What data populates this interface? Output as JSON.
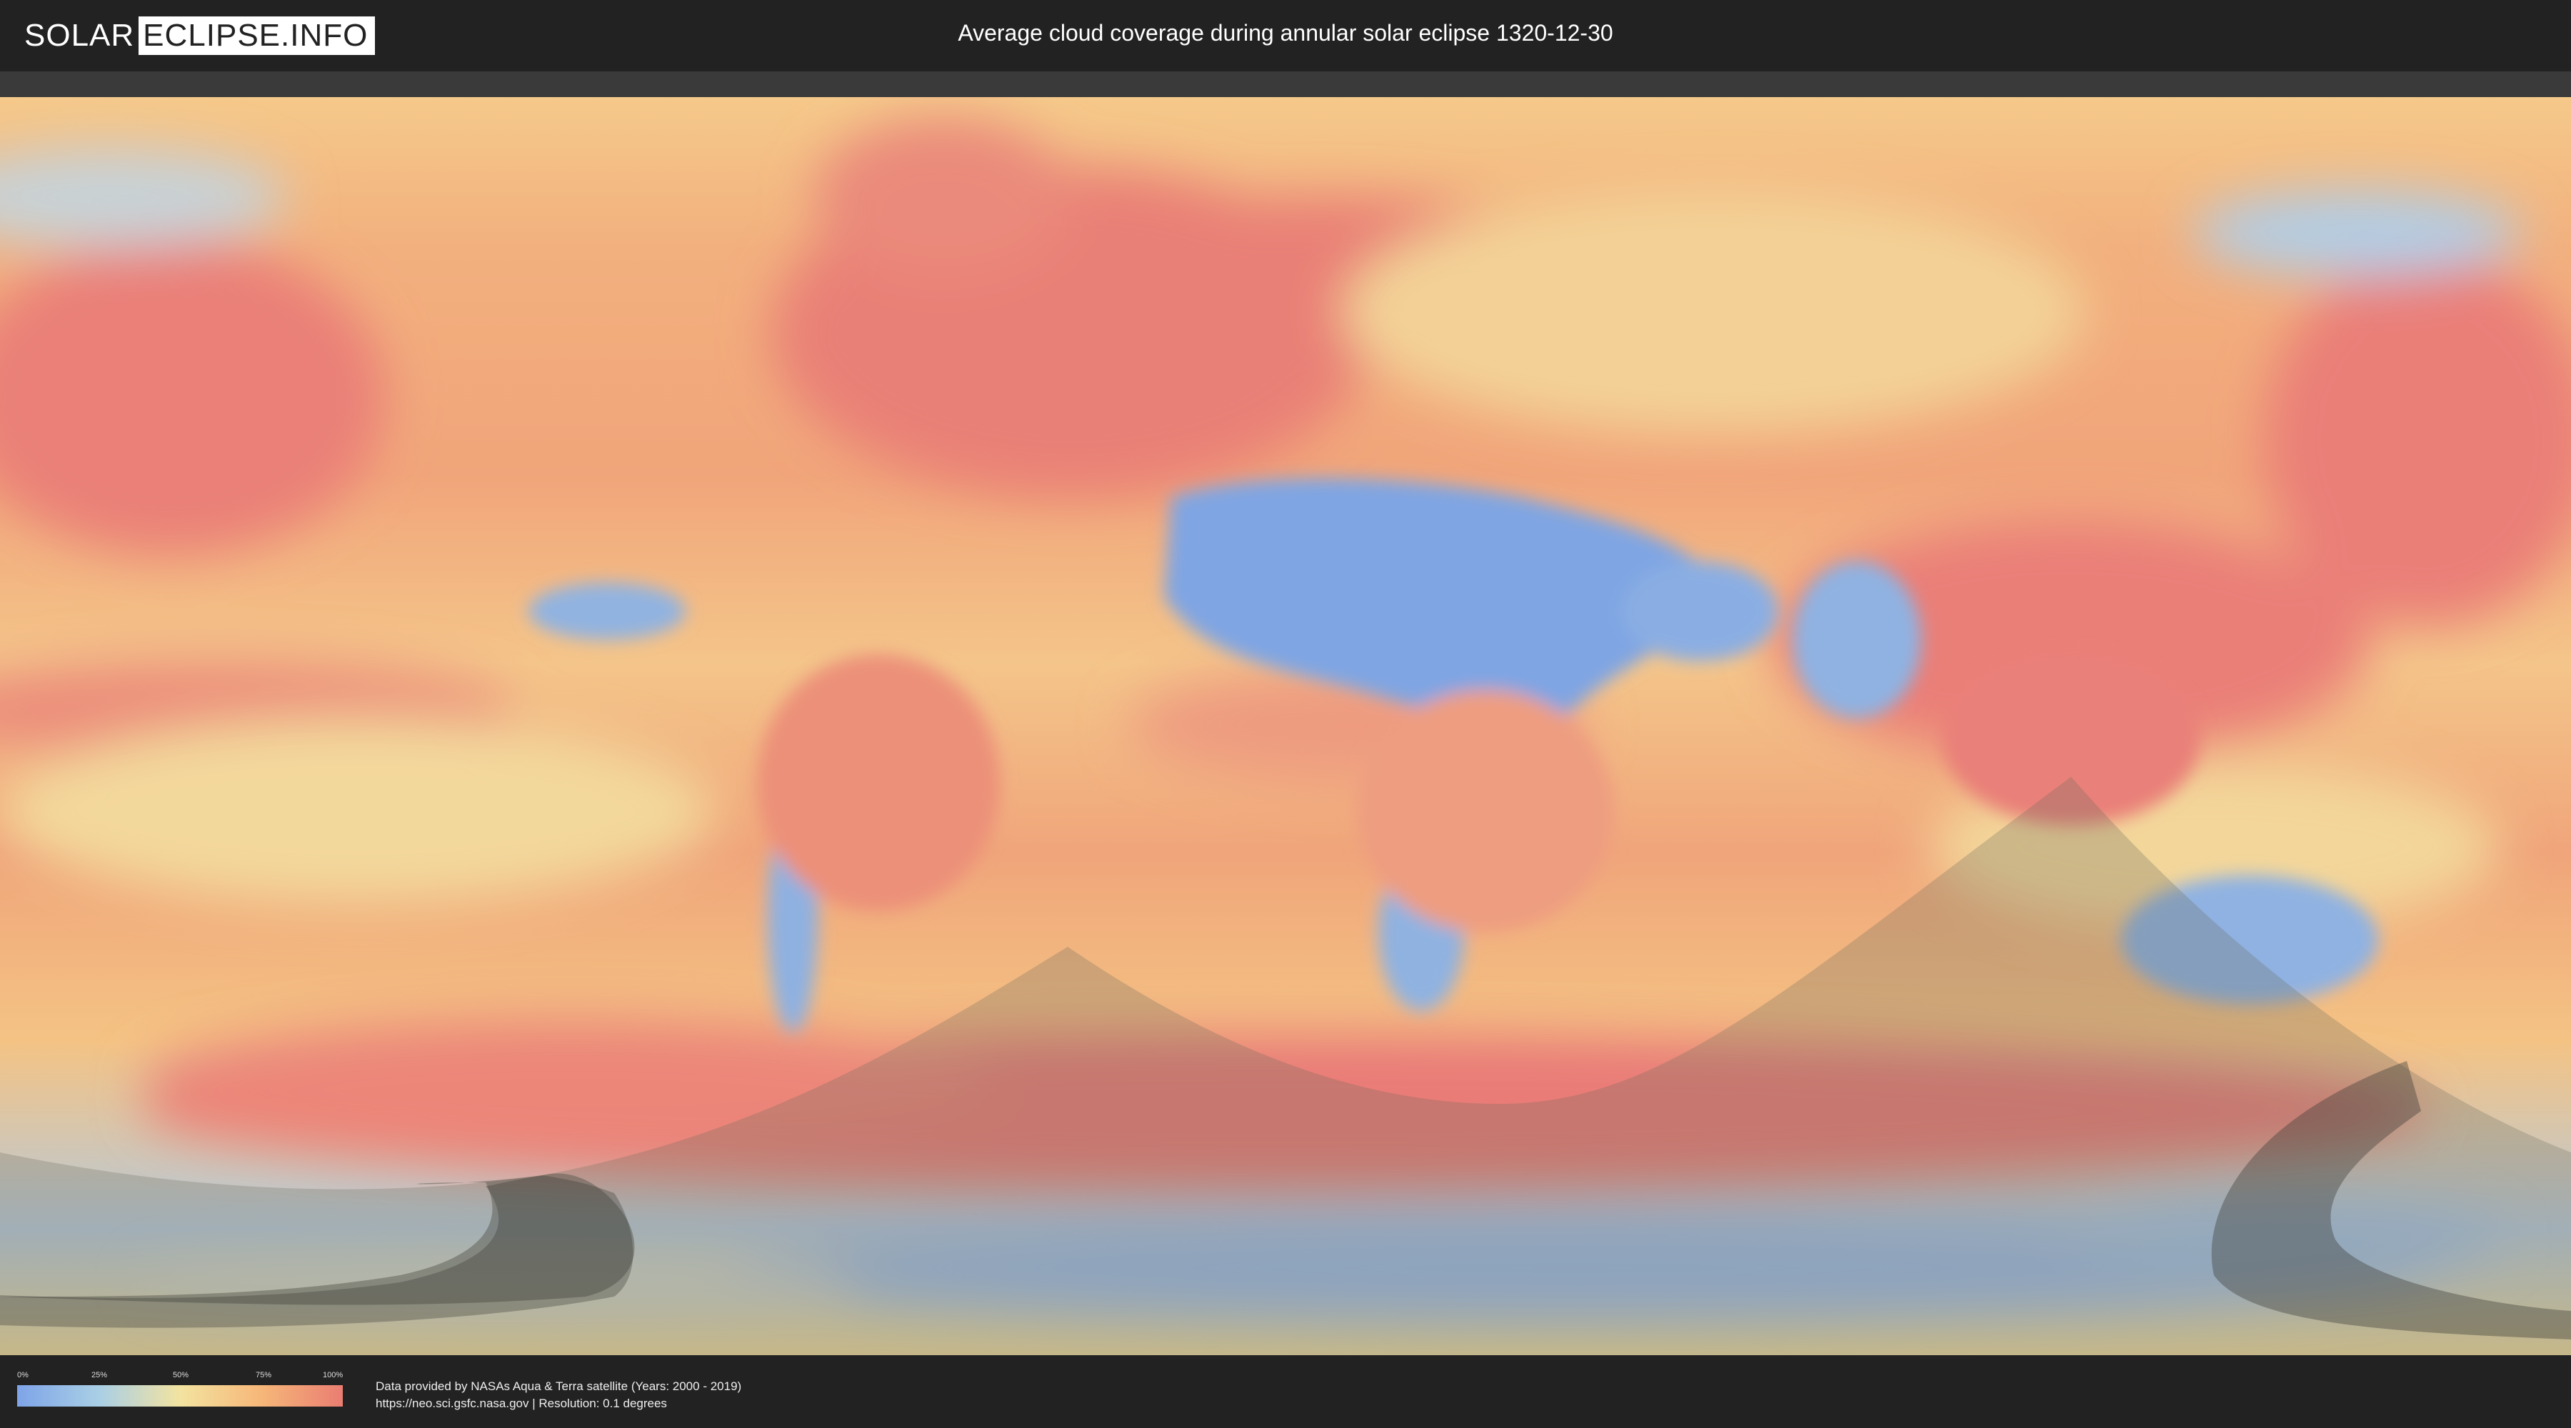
{
  "header": {
    "logo_left": "SOLAR",
    "logo_right": "ECLIPSE.INFO",
    "title": "Average cloud coverage during annular solar eclipse 1320-12-30"
  },
  "legend": {
    "ticks": [
      "0%",
      "25%",
      "50%",
      "75%",
      "100%"
    ],
    "colors": [
      "#7ea4e8",
      "#a9cfe6",
      "#f3e3a0",
      "#f6b779",
      "#ea7d72"
    ]
  },
  "footer": {
    "credit_line1": "Data provided by NASAs Aqua & Terra satellite (Years: 2000 - 2019)",
    "credit_line2": "https://neo.sci.gsfc.nasa.gov | Resolution: 0.1 degrees"
  },
  "map": {
    "type": "world cloud coverage map (equirectangular)",
    "overlay": "eclipse visibility region (shaded)"
  }
}
